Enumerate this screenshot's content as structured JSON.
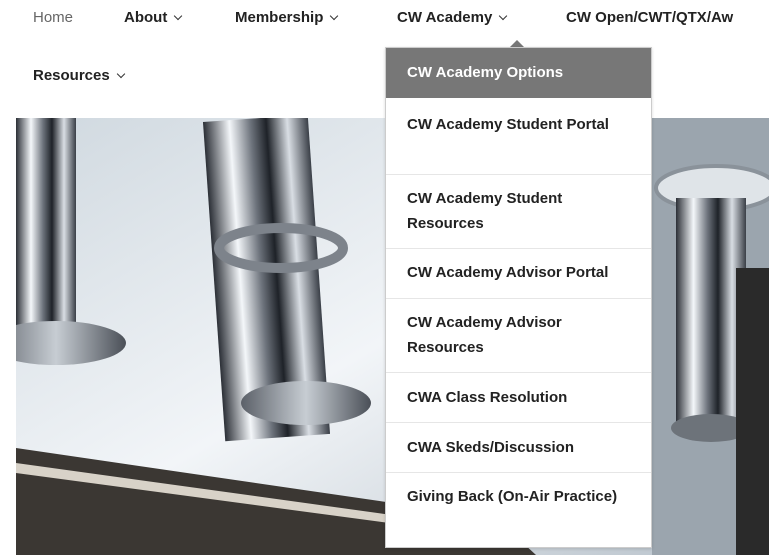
{
  "nav": {
    "items": [
      {
        "label": "Home",
        "has_caret": false
      },
      {
        "label": "About",
        "has_caret": true
      },
      {
        "label": "Membership",
        "has_caret": true
      },
      {
        "label": "CW Academy",
        "has_caret": true
      },
      {
        "label": "CW Open/CWT/QTX/Aw",
        "has_caret": false
      },
      {
        "label": "Resources",
        "has_caret": true
      }
    ]
  },
  "dropdown": {
    "items": [
      {
        "label": "CW Academy Options",
        "active": true
      },
      {
        "label": "CW Academy Student Portal"
      },
      {
        "label": "CW Academy Student Resources"
      },
      {
        "label": "CW Academy Advisor Portal"
      },
      {
        "label": "CW Academy Advisor Resources"
      },
      {
        "label": "CWA Class Resolution"
      },
      {
        "label": "CWA Skeds/Discussion"
      },
      {
        "label": "Giving Back (On-Air Practice)"
      }
    ]
  },
  "colors": {
    "active_bg": "#777777",
    "text": "#222222",
    "home_text": "#666666"
  },
  "icons": {
    "caret": "chevron-down-icon"
  }
}
